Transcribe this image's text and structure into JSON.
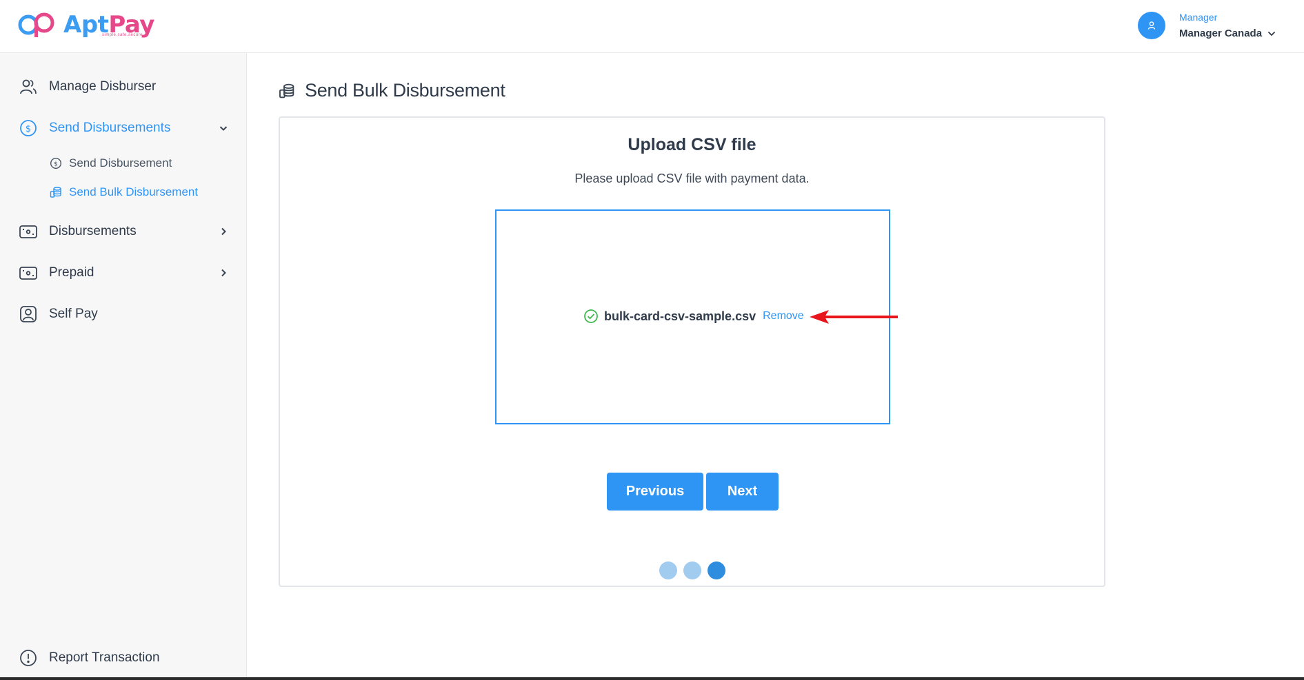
{
  "header": {
    "logo_main": "Apt",
    "logo_accent": "Pay",
    "logo_tagline": "simple.safe.secure",
    "user_role": "Manager",
    "user_name": "Manager Canada"
  },
  "sidebar": {
    "items": [
      {
        "label": "Manage Disburser",
        "icon": "users-icon"
      },
      {
        "label": "Send Disbursements",
        "icon": "dollar-circle-icon",
        "expanded": true
      },
      {
        "label": "Disbursements",
        "icon": "cash-icon"
      },
      {
        "label": "Prepaid",
        "icon": "cash-icon"
      },
      {
        "label": "Self Pay",
        "icon": "user-badge-icon"
      }
    ],
    "sub_items": [
      {
        "label": "Send Disbursement",
        "icon": "dollar-circle-icon"
      },
      {
        "label": "Send Bulk Disbursement",
        "icon": "coins-stack-icon",
        "active": true
      }
    ],
    "footer_item": {
      "label": "Report Transaction",
      "icon": "alert-circle-icon"
    }
  },
  "main": {
    "page_title": "Send Bulk Disbursement",
    "card": {
      "title": "Upload CSV file",
      "subtitle": "Please upload CSV file with payment data.",
      "file_name": "bulk-card-csv-sample.csv",
      "remove_label": "Remove",
      "previous_label": "Previous",
      "next_label": "Next",
      "steps_total": 3,
      "current_step": 3
    }
  },
  "colors": {
    "accent": "#2f95f5",
    "brand_pink": "#e6488a",
    "success": "#3fb950",
    "annotation_arrow": "#e8151c"
  }
}
